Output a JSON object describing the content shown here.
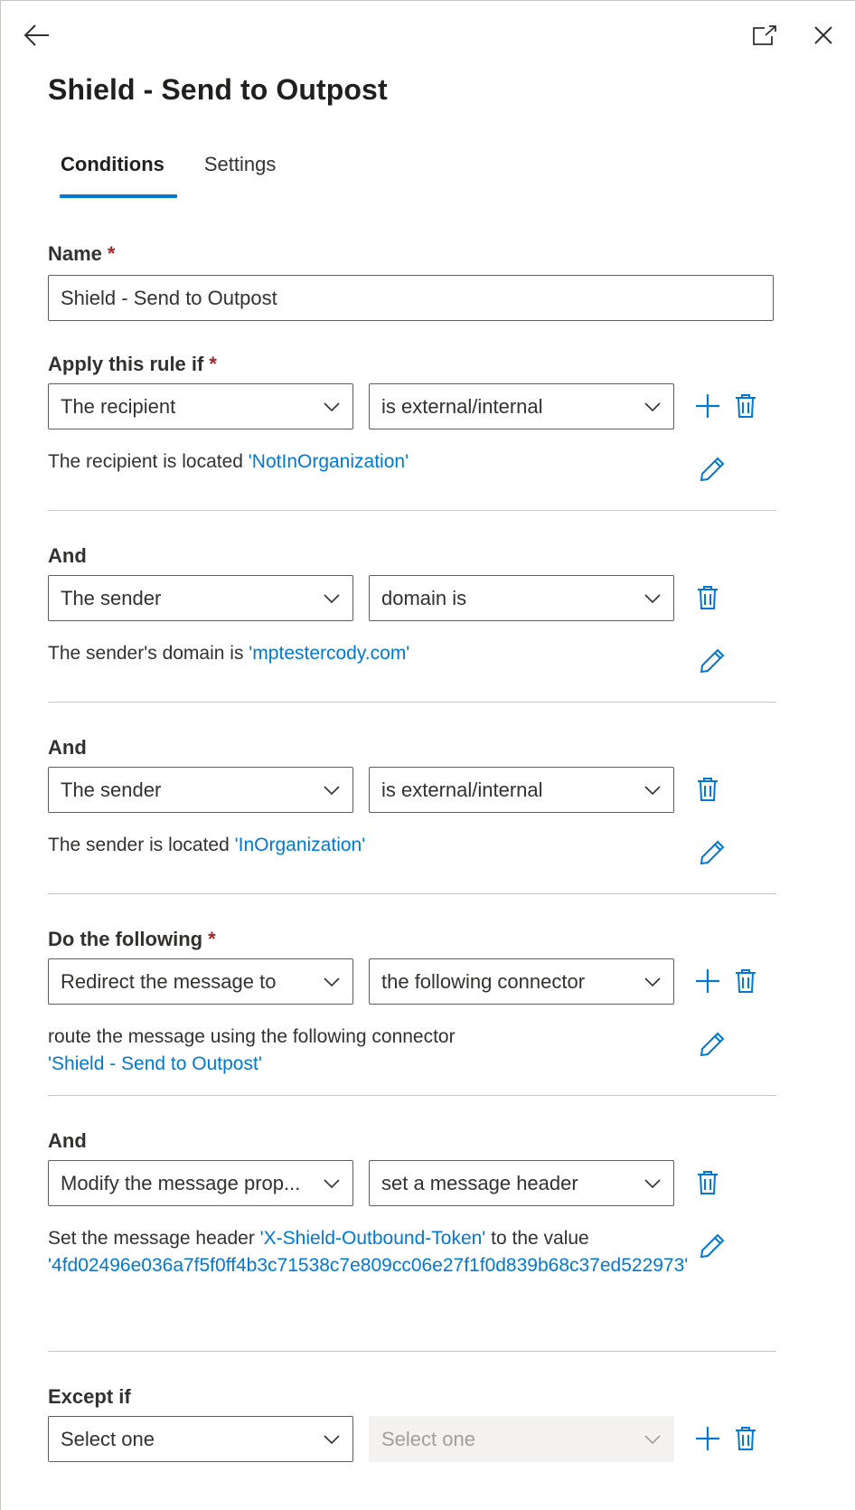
{
  "header": {
    "title": "Shield - Send to Outpost"
  },
  "tabs": [
    {
      "label": "Conditions"
    },
    {
      "label": "Settings"
    }
  ],
  "name_field": {
    "label": "Name",
    "required_mark": "*",
    "value": "Shield - Send to Outpost"
  },
  "apply_section": {
    "label": "Apply this rule if",
    "required_mark": "*",
    "field": "The recipient",
    "operator": "is external/internal",
    "summary_text": "The recipient is located ",
    "summary_value": "'NotInOrganization'"
  },
  "and_1": {
    "label": "And",
    "field": "The sender",
    "operator": "domain is",
    "summary_text": "The sender's domain is ",
    "summary_value": "'mptestercody.com'"
  },
  "and_2": {
    "label": "And",
    "field": "The sender",
    "operator": "is external/internal",
    "summary_text": "The sender is located ",
    "summary_value": "'InOrganization'"
  },
  "do_section": {
    "label": "Do the following",
    "required_mark": "*",
    "field": "Redirect the message to",
    "operator": "the following connector",
    "summary_text": "route the message using the following connector",
    "summary_value": "'Shield - Send to Outpost'"
  },
  "and_3": {
    "label": "And",
    "field": "Modify the message prop...",
    "operator": "set a message header",
    "summary_text_1": "Set the message header ",
    "summary_value_1": "'X-Shield-Outbound-Token'",
    "summary_text_2": " to the value",
    "summary_value_2": "'4fd02496e036a7f5f0ff4b3c71538c7e809cc06e27f1f0d839b68c37ed522973'"
  },
  "except_section": {
    "label": "Except if",
    "field": "Select one",
    "operator": "Select one"
  },
  "colors": {
    "accent": "#0078d4",
    "required": "#a4262c",
    "text": "#323130",
    "border": "#605e5c",
    "separator": "#c8c6c4"
  }
}
